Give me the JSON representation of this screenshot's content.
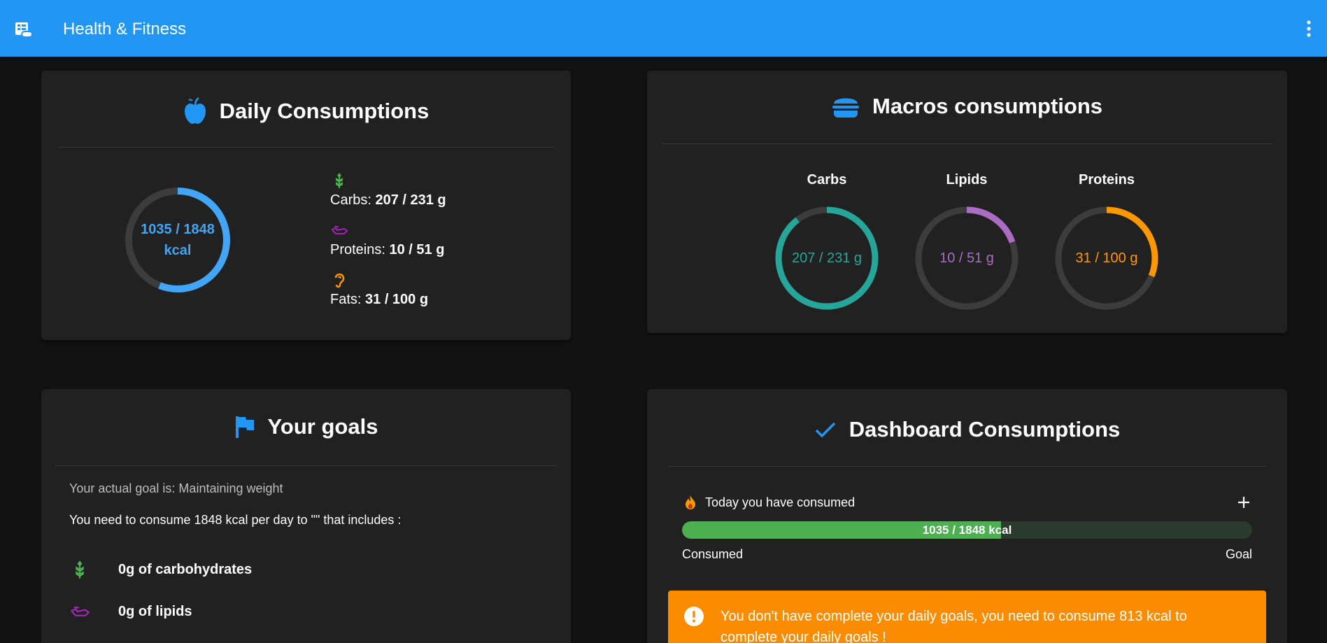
{
  "app": {
    "title": "Health & Fitness"
  },
  "daily": {
    "title": "Daily Consumptions",
    "kcal_value": "1035 / 1848",
    "kcal_unit": "kcal",
    "kcal_consumed": 1035,
    "kcal_goal": 1848,
    "carbs_label": "Carbs:",
    "carbs_value": "207 / 231 g",
    "proteins_label": "Proteins:",
    "proteins_value": "10 / 51 g",
    "fats_label": "Fats:",
    "fats_value": "31 / 100 g"
  },
  "macros": {
    "title": "Macros consumptions",
    "items": [
      {
        "title": "Carbs",
        "label": "207 / 231 g",
        "consumed": 207,
        "goal": 231,
        "color": "#26a69a"
      },
      {
        "title": "Lipids",
        "label": "10 / 51 g",
        "consumed": 10,
        "goal": 51,
        "color": "#ab6cc4"
      },
      {
        "title": "Proteins",
        "label": "31 / 100 g",
        "consumed": 31,
        "goal": 100,
        "color": "#ff9800"
      }
    ]
  },
  "goals": {
    "title": "Your goals",
    "actual_goal": "Your actual goal is: Maintaining weight",
    "need_text": "You need to consume 1848 kcal per day to \"\" that includes :",
    "carbs_item": "0g of carbohydrates",
    "lipids_item": "0g of lipids"
  },
  "dashboard": {
    "title": "Dashboard Consumptions",
    "today_label": "Today you have consumed",
    "bar_text": "1035 / 1848 kcal",
    "progress_fraction": 0.56,
    "consumed_label": "Consumed",
    "goal_label": "Goal",
    "alert_text": "You don't have complete your daily goals, you need to consume 813 kcal to complete your daily goals !"
  },
  "colors": {
    "primary": "#2196f3",
    "carbs": "#4caf50",
    "proteins": "#9c27b0",
    "fats": "#ff9800",
    "warning": "#fb8c00",
    "ring_track": "#3c3c3c"
  }
}
